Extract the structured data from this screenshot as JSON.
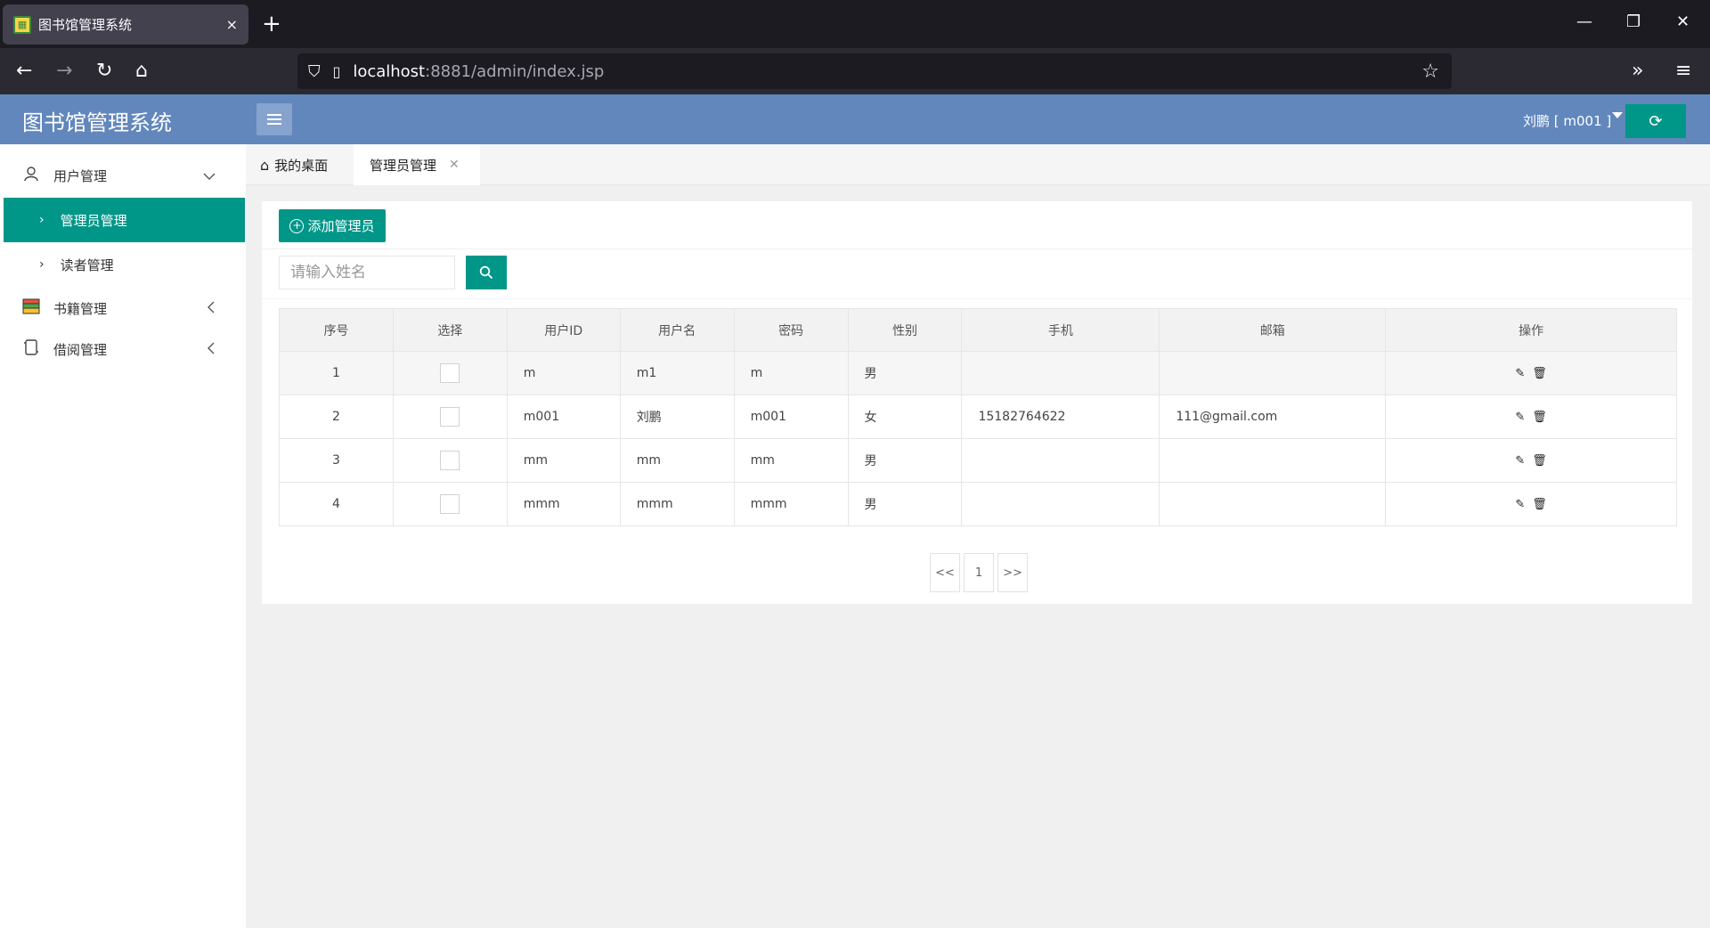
{
  "browser": {
    "tab_title": "图书馆管理系统",
    "tab_close": "×",
    "new_tab": "+",
    "url_host": "localhost",
    "url_rest": ":8881/admin/index.jsp",
    "controls": {
      "minimize": "—",
      "restore": "❐",
      "close": "✕"
    }
  },
  "header": {
    "logo": "图书馆管理系统",
    "user": "刘鹏 [ m001 ]",
    "refresh_icon": "⟳"
  },
  "sidebar": {
    "groups": [
      {
        "label": "用户管理",
        "icon": "user-icon"
      },
      {
        "label": "书籍管理",
        "icon": "books-icon"
      },
      {
        "label": "借阅管理",
        "icon": "scroll-icon"
      }
    ],
    "subitems": [
      {
        "label": "管理员管理",
        "active": true
      },
      {
        "label": "读者管理",
        "active": false
      }
    ]
  },
  "page_tabs": {
    "home": "我的桌面",
    "current": "管理员管理"
  },
  "toolbar": {
    "add_label": "添加管理员"
  },
  "search": {
    "placeholder": "请输入姓名",
    "value": ""
  },
  "table": {
    "headers": [
      "序号",
      "选择",
      "用户ID",
      "用户名",
      "密码",
      "性别",
      "手机",
      "邮箱",
      "操作"
    ],
    "rows": [
      {
        "no": "1",
        "id": "m",
        "name": "m1",
        "pwd": "m",
        "sex": "男",
        "phone": "",
        "email": ""
      },
      {
        "no": "2",
        "id": "m001",
        "name": "刘鹏",
        "pwd": "m001",
        "sex": "女",
        "phone": "15182764622",
        "email": "111@gmail.com"
      },
      {
        "no": "3",
        "id": "mm",
        "name": "mm",
        "pwd": "mm",
        "sex": "男",
        "phone": "",
        "email": ""
      },
      {
        "no": "4",
        "id": "mmm",
        "name": "mmm",
        "pwd": "mmm",
        "sex": "男",
        "phone": "",
        "email": ""
      }
    ]
  },
  "pager": {
    "prev": "<<",
    "page": "1",
    "next": ">>"
  },
  "colors": {
    "header": "#6187bd",
    "accent": "#009688"
  }
}
